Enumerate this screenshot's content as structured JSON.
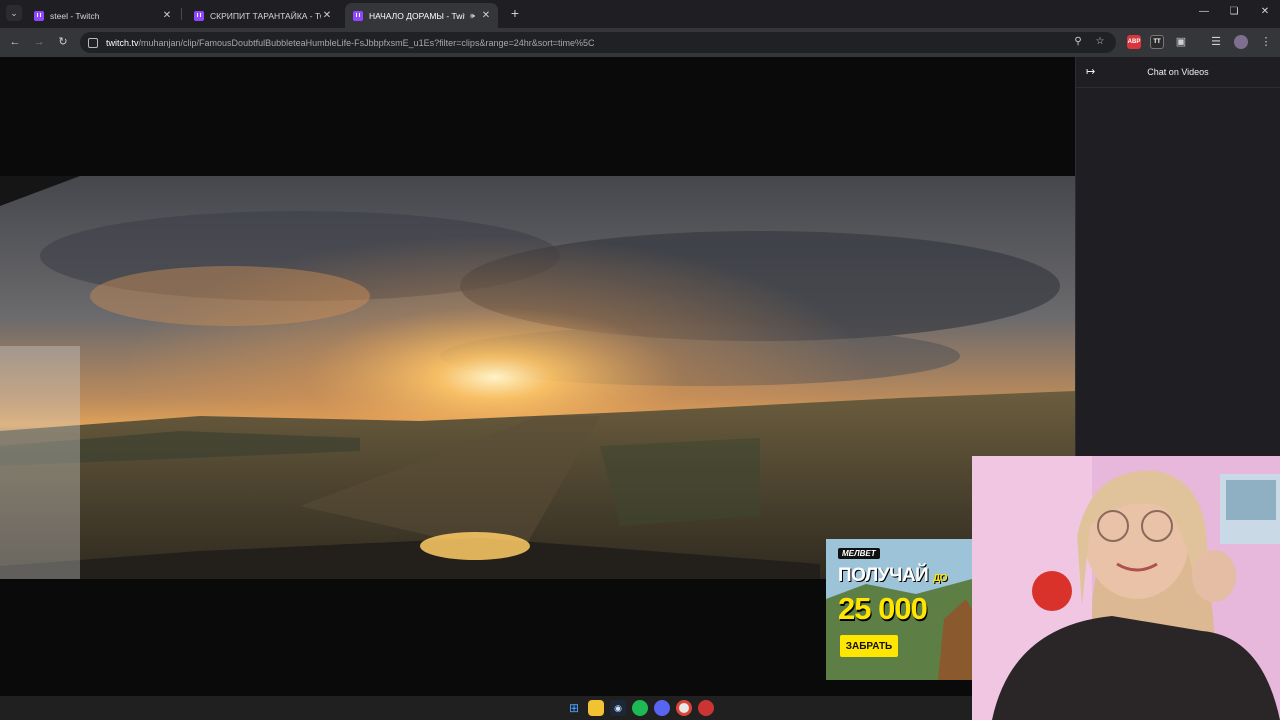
{
  "browser": {
    "tabs": [
      {
        "title": "steel - Twitch",
        "active": false,
        "audio": false
      },
      {
        "title": "СКРИПИТ ТАРАНТАЙКА - Twitch",
        "active": false,
        "audio": false
      },
      {
        "title": "НАЧАЛО ДОРАМЫ - Twitch",
        "active": true,
        "audio": true
      }
    ],
    "new_tab_icon": "plus-icon",
    "window_controls": [
      "minimize-icon",
      "restore-icon",
      "close-icon"
    ]
  },
  "toolbar": {
    "url_host": "twitch.tv",
    "url_path": "/muhanjan/clip/FamousDoubtfulBubbleteaHumbleLife-FsJbbpfxsmE_u1Es?filter=clips&range=24hr&sort=time%5C",
    "extensions": [
      {
        "name": "ABP",
        "color": "#d9353b"
      },
      {
        "name": "TT",
        "color": "#2b2b2b"
      }
    ]
  },
  "chat": {
    "title": "Chat on Videos"
  },
  "ad": {
    "brand": "МЕЛBET",
    "line1": "ПОЛУЧАЙ",
    "line1_small": "ДО",
    "amount": "25 000",
    "button": "ЗАБРАТЬ",
    "accent": "#ffe600"
  },
  "colors": {
    "twitch_purple": "#9146ff",
    "chrome_dark": "#35363a",
    "tab_strip": "#1f1f23"
  }
}
